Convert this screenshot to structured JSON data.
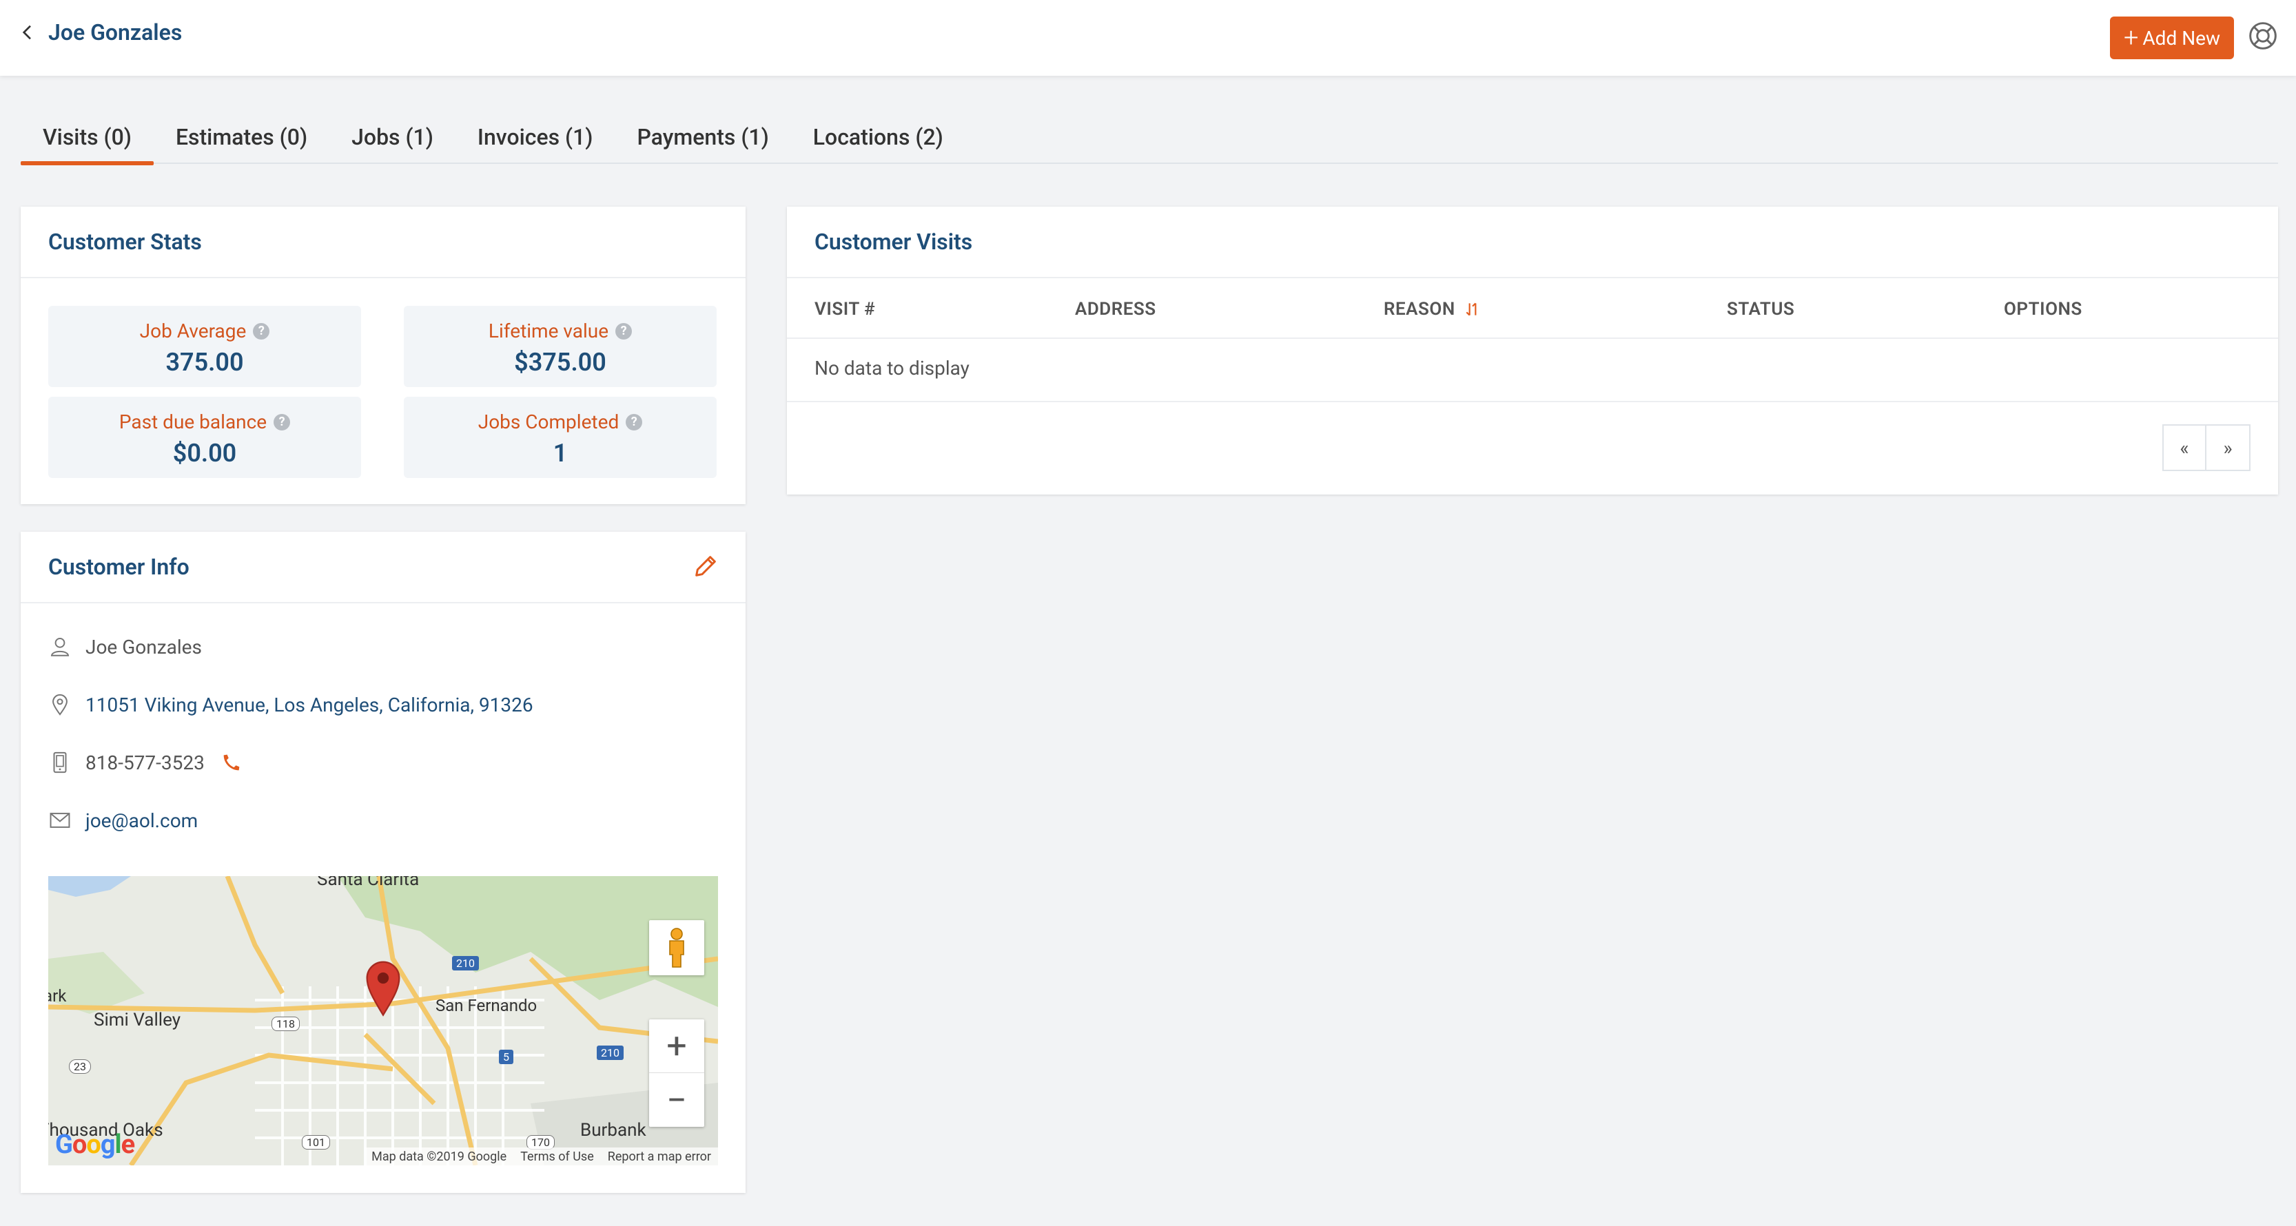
{
  "header": {
    "customer_name": "Joe Gonzales",
    "add_new_label": "Add New",
    "accent_color": "#e25c1e"
  },
  "tabs": [
    {
      "label": "Visits (0)",
      "active": true
    },
    {
      "label": "Estimates (0)",
      "active": false
    },
    {
      "label": "Jobs (1)",
      "active": false
    },
    {
      "label": "Invoices (1)",
      "active": false
    },
    {
      "label": "Payments (1)",
      "active": false
    },
    {
      "label": "Locations (2)",
      "active": false
    }
  ],
  "customer_stats": {
    "title": "Customer Stats",
    "items": [
      {
        "label": "Job Average",
        "value": "375.00"
      },
      {
        "label": "Lifetime value",
        "value": "$375.00"
      },
      {
        "label": "Past due balance",
        "value": "$0.00"
      },
      {
        "label": "Jobs Completed",
        "value": "1"
      }
    ]
  },
  "customer_info": {
    "title": "Customer Info",
    "name": "Joe Gonzales",
    "address": "11051 Viking Avenue, Los Angeles, California, 91326",
    "phone": "818-577-3523",
    "email": "joe@aol.com"
  },
  "map": {
    "labels": {
      "santa_clarita": "Santa Clarita",
      "park": "Park",
      "simi_valley": "Simi Valley",
      "san_fernando": "San Fernando",
      "thousand_oaks": "Thousand Oaks",
      "burbank": "Burbank"
    },
    "shields": [
      "210",
      "118",
      "5",
      "210",
      "23",
      "101",
      "170"
    ],
    "attribution": {
      "map_data": "Map data ©2019 Google",
      "terms": "Terms of Use",
      "report": "Report a map error"
    },
    "google_logo": "Google",
    "zoom_in": "+",
    "zoom_out": "−"
  },
  "customer_visits": {
    "title": "Customer Visits",
    "columns": [
      "VISIT #",
      "ADDRESS",
      "REASON",
      "STATUS",
      "OPTIONS"
    ],
    "empty_text": "No data to display",
    "pager": {
      "prev": "«",
      "next": "»"
    }
  }
}
